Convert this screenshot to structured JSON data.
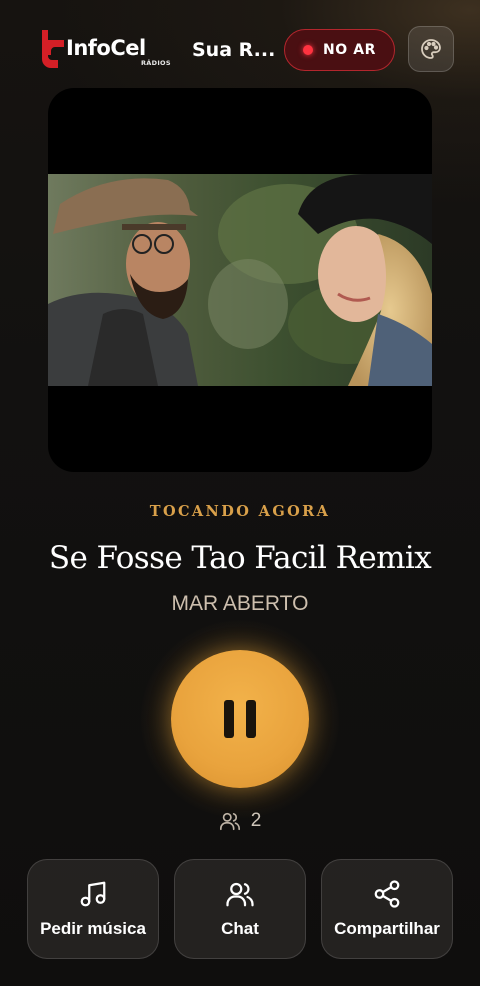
{
  "header": {
    "logo_text": "InfoCel",
    "logo_sub": "RÁDIOS",
    "station_name": "Sua R...",
    "live_label": "NO AR",
    "theme_icon": "palette-icon"
  },
  "player": {
    "now_playing_label": "TOCANDO AGORA",
    "song_title": "Se Fosse Tao Facil Remix",
    "artist": "MAR ABERTO",
    "state": "playing",
    "listeners": "2"
  },
  "actions": [
    {
      "label": "Pedir música",
      "icon": "music-note-icon"
    },
    {
      "label": "Chat",
      "icon": "users-icon"
    },
    {
      "label": "Compartilhar",
      "icon": "share-icon"
    }
  ],
  "colors": {
    "accent": "#e9a33d",
    "live": "#ff3340",
    "logo_red": "#d41f26"
  }
}
